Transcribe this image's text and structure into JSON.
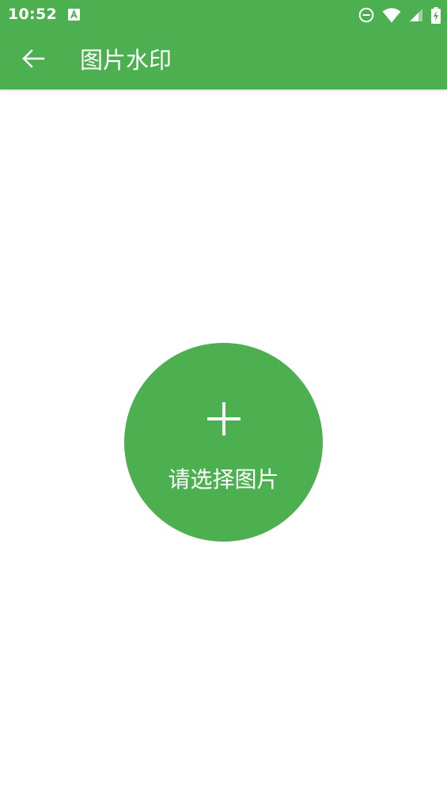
{
  "status_bar": {
    "time": "10:52",
    "icons": [
      "text-a-notification-icon",
      "do-not-disturb-icon",
      "wifi-icon",
      "cell-signal-icon",
      "battery-charging-icon"
    ]
  },
  "app_bar": {
    "back_icon": "arrow-left-icon",
    "title": "图片水印"
  },
  "main": {
    "select_button": {
      "icon": "plus-icon",
      "label": "请选择图片"
    }
  },
  "colors": {
    "primary": "#4caf50",
    "on_primary": "#ffffff",
    "background": "#ffffff"
  }
}
